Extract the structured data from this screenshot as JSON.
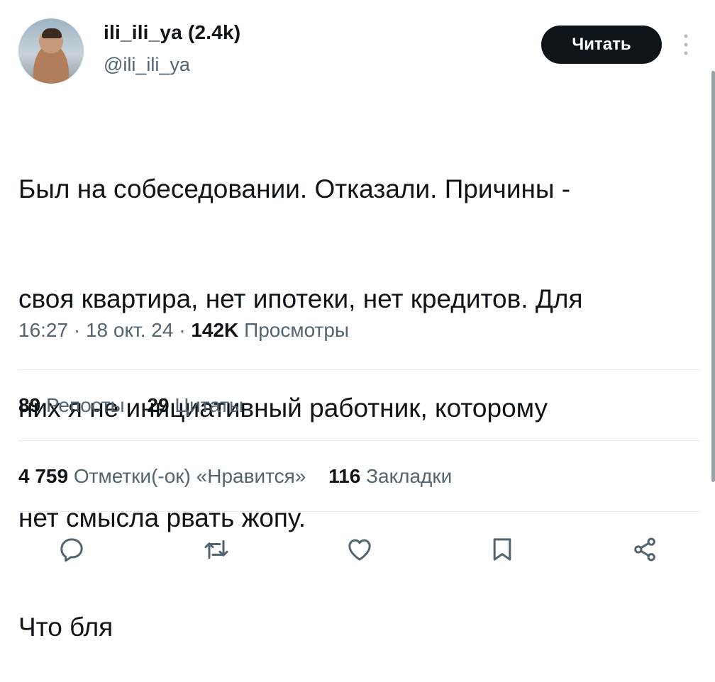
{
  "author": {
    "name": "ili_ili_ya (2.4k)",
    "handle": "@ili_ili_ya",
    "avatar_icon": "profile-photo"
  },
  "follow_button": {
    "label": "Читать"
  },
  "more_icon": "vertical-dots-icon",
  "tweet": {
    "lines": [
      "Был на собеседовании. Отказали. Причины -",
      "своя квартира, нет ипотеки, нет кредитов. Для",
      "них я не инициативный работник, которому",
      "нет смысла рвать жопу.",
      "Что бля"
    ]
  },
  "meta": {
    "time": "16:27",
    "separator": " · ",
    "date": "18 окт. 24",
    "views_count": "142K",
    "views_label": "Просмотры"
  },
  "stats_row1": [
    {
      "count": "89",
      "label": "Репосты"
    },
    {
      "count": "29",
      "label": "Цитаты"
    }
  ],
  "stats_row2": [
    {
      "count": "4 759",
      "label": "Отметки(-ок) «Нравится»"
    },
    {
      "count": "116",
      "label": "Закладки"
    }
  ],
  "actions": [
    "reply-icon",
    "retweet-icon",
    "like-icon",
    "bookmark-icon",
    "share-icon"
  ],
  "colors": {
    "text": "#0f1419",
    "secondary": "#536471",
    "button": "#0f1419",
    "divider": "#e6e9eb"
  }
}
